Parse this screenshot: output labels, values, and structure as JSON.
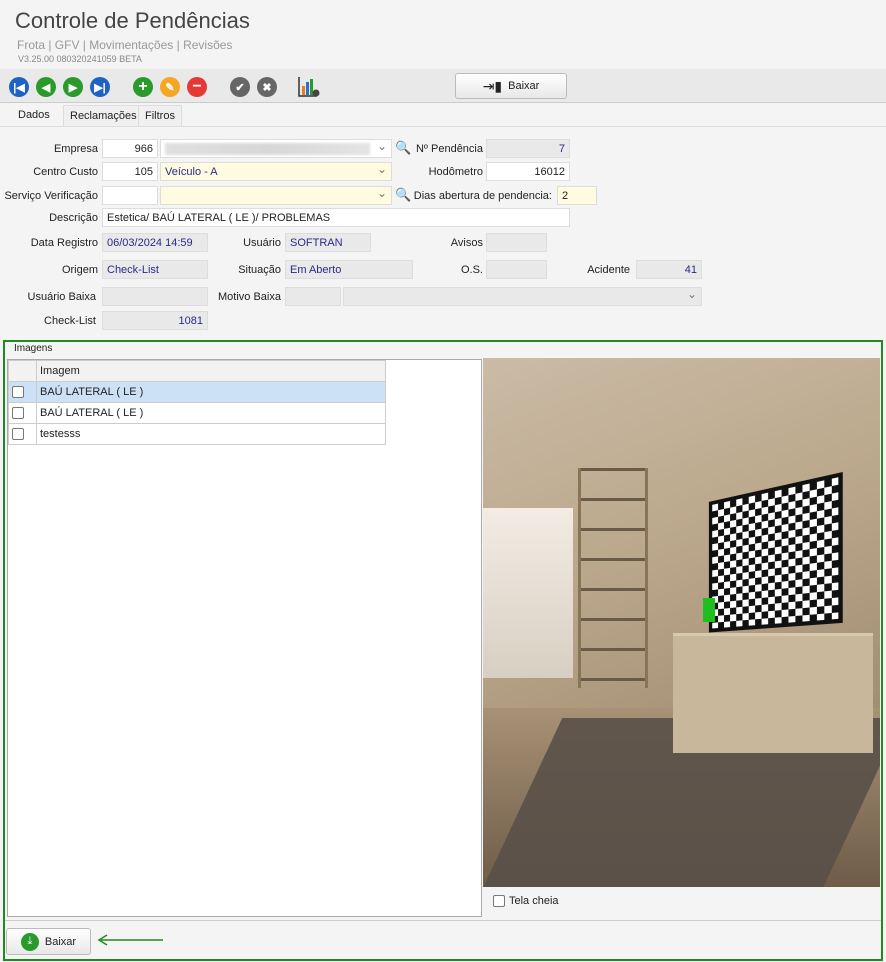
{
  "header": {
    "title": "Controle de Pendências",
    "breadcrumb": "Frota | GFV | Movimentações | Revisões",
    "version": "V3.25.00 080320241059 BETA"
  },
  "toolbar": {
    "baixar_label": "Baixar"
  },
  "tabs": [
    "Dados",
    "Reclamações",
    "Filtros"
  ],
  "form": {
    "empresa_label": "Empresa",
    "empresa_code": "966",
    "pendencia_label": "Nº Pendência",
    "pendencia": "7",
    "centro_label": "Centro Custo",
    "centro_code": "105",
    "centro_name": "Veículo - A",
    "hodometro_label": "Hodômetro",
    "hodometro": "16012",
    "servico_label": "Serviço Verificação",
    "dias_label": "Dias abertura de pendencia:",
    "dias": "2",
    "descricao_label": "Descrição",
    "descricao": "Estetica/ BAÚ LATERAL ( LE )/ PROBLEMAS",
    "data_label": "Data Registro",
    "data": "06/03/2024 14:59",
    "usuario_label": "Usuário",
    "usuario": "SOFTRAN",
    "avisos_label": "Avisos",
    "origem_label": "Origem",
    "origem": "Check-List",
    "situacao_label": "Situação",
    "situacao": "Em Aberto",
    "os_label": "O.S.",
    "acidente_label": "Acidente",
    "acidente": "41",
    "usuario_baixa_label": "Usuário Baixa",
    "motivo_label": "Motivo Baixa",
    "checklist_label": "Check-List",
    "checklist": "1081"
  },
  "images": {
    "group_label": "Imagens",
    "column": "Imagem",
    "rows": [
      "BAÚ LATERAL ( LE )",
      "BAÚ LATERAL ( LE )",
      "testesss"
    ],
    "fullscreen_label": "Tela cheia",
    "baixar_label": "Baixar"
  }
}
